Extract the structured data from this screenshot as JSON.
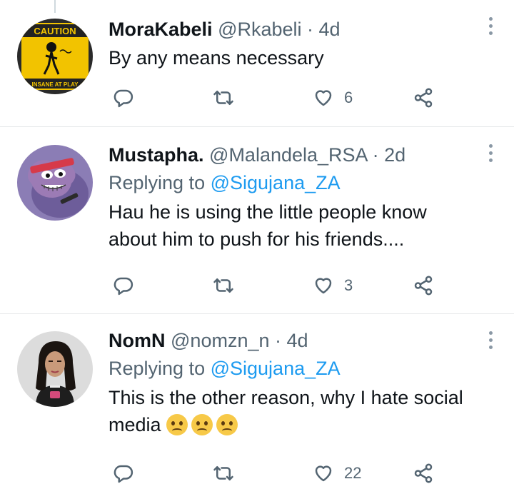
{
  "tweets": [
    {
      "name": "MoraKabeli",
      "handle": "@Rkabeli",
      "time": "· 4d",
      "replying_label": "",
      "replying_handle": "",
      "text": "By any means necessary",
      "likes": "6",
      "avatar": {
        "top_text": "CAUTION",
        "bottom_text": "INSANE AT PLAY",
        "bg": "#f2c300"
      }
    },
    {
      "name": "Mustapha.",
      "handle": "@Malandela_RSA",
      "time": "· 2d",
      "replying_label": "Replying to",
      "replying_handle": "@Sigujana_ZA",
      "text": "Hau he is using the little people know about him to push for his friends....",
      "likes": "3",
      "avatar": {
        "bg": "#7a6aa8"
      }
    },
    {
      "name": "NomN",
      "handle": "@nomzn_n",
      "time": "· 4d",
      "replying_label": "Replying to",
      "replying_handle": "@Sigujana_ZA",
      "text": "This is the other reason, why I hate social media",
      "likes": "22",
      "avatar": {
        "bg": "#d8d8d8"
      }
    }
  ],
  "icons": {
    "reply": "reply-icon",
    "retweet": "retweet-icon",
    "like": "heart-icon",
    "share": "share-icon",
    "more": "more-icon",
    "emoji": "woozy-face-emoji"
  },
  "colors": {
    "link": "#1d9bf0",
    "muted": "#536471",
    "icon": "#536471"
  }
}
